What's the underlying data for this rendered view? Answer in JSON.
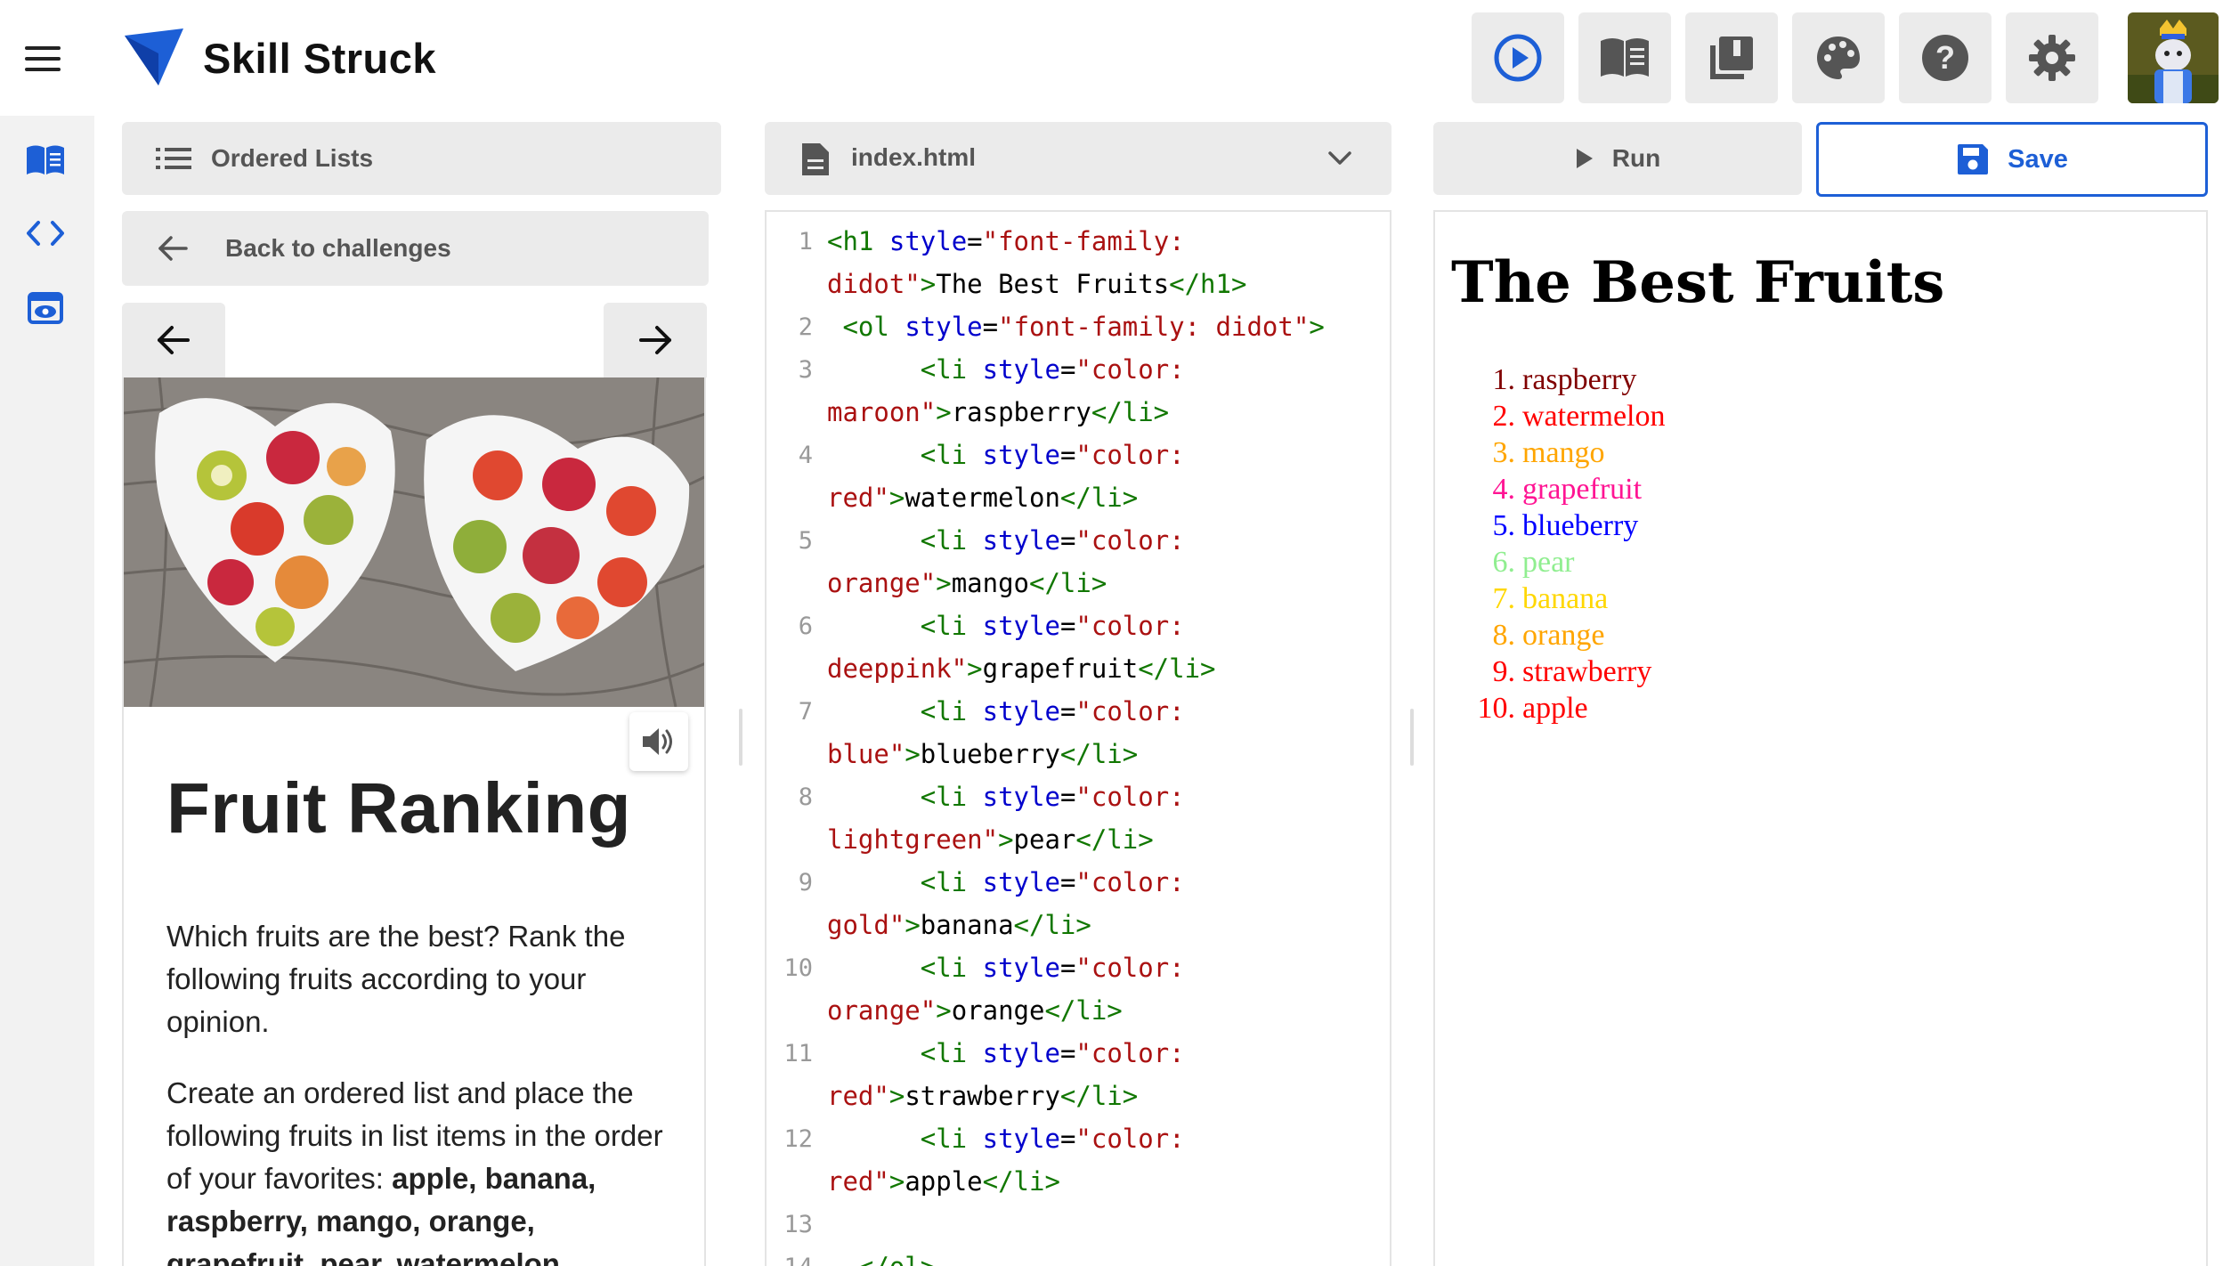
{
  "header": {
    "brand": "Skill Struck",
    "tools": [
      {
        "icon": "play-circle-icon",
        "active": true
      },
      {
        "icon": "open-book-icon"
      },
      {
        "icon": "library-books-icon"
      },
      {
        "icon": "palette-icon"
      },
      {
        "icon": "help-icon"
      },
      {
        "icon": "settings-gear-icon"
      }
    ],
    "avatar_icon": "user-avatar-icon"
  },
  "rail": {
    "items": [
      {
        "icon": "lesson-book-icon",
        "active": true
      },
      {
        "icon": "code-brackets-icon"
      },
      {
        "icon": "eye-preview-icon"
      }
    ]
  },
  "lesson": {
    "section": "Ordered Lists",
    "back": "Back to challenges",
    "title": "Fruit Ranking",
    "p1": "Which fruits are the best? Rank the following fruits according to your opinion.",
    "p2_lead": "Create an ordered list and place the following fruits in list items in the order of your favorites: ",
    "p2_bold": "apple, banana, raspberry, mango, orange, grapefruit, pear, watermelon"
  },
  "editor": {
    "filename": "index.html",
    "line_numbers": [
      "1",
      "",
      "2",
      "3",
      "",
      "4",
      "",
      "5",
      "",
      "6",
      "",
      "7",
      "",
      "8",
      "",
      "9",
      "",
      "10",
      "",
      "11",
      "",
      "12",
      "",
      "13",
      "14"
    ]
  },
  "preview": {
    "run_label": "Run",
    "save_label": "Save",
    "heading": "The Best Fruits",
    "items": [
      {
        "n": "1.",
        "text": "raspberry",
        "color": "#800000"
      },
      {
        "n": "2.",
        "text": "watermelon",
        "color": "#ff0000"
      },
      {
        "n": "3.",
        "text": "mango",
        "color": "#ffa500"
      },
      {
        "n": "4.",
        "text": "grapefruit",
        "color": "#ff1493"
      },
      {
        "n": "5.",
        "text": "blueberry",
        "color": "#0000ff"
      },
      {
        "n": "6.",
        "text": "pear",
        "color": "#90ee90"
      },
      {
        "n": "7.",
        "text": "banana",
        "color": "#ffd700"
      },
      {
        "n": "8.",
        "text": "orange",
        "color": "#ffa500"
      },
      {
        "n": "9.",
        "text": "strawberry",
        "color": "#ff0000"
      },
      {
        "n": "10.",
        "text": "apple",
        "color": "#ff0000"
      }
    ]
  },
  "colors": {
    "accent": "#1d5fd6",
    "panel": "#ebebeb",
    "tag": "#117700",
    "attr": "#0000cc",
    "string": "#aa1111"
  }
}
